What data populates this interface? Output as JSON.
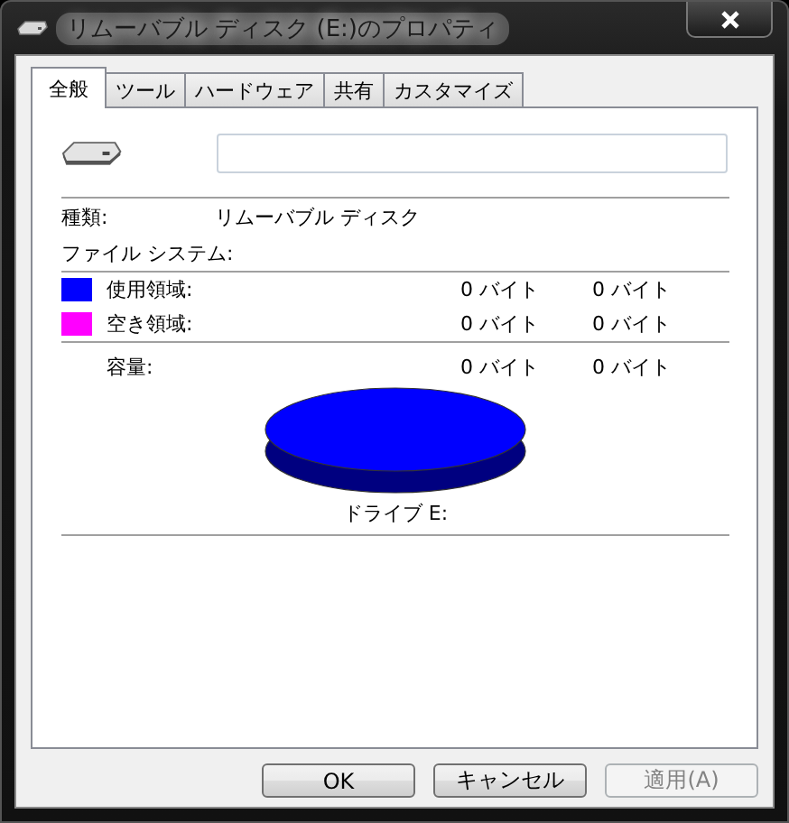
{
  "window": {
    "title": "リムーバブル ディスク (E:)のプロパティ"
  },
  "tabs": [
    {
      "label": "全般",
      "selected": true
    },
    {
      "label": "ツール",
      "selected": false
    },
    {
      "label": "ハードウェア",
      "selected": false
    },
    {
      "label": "共有",
      "selected": false
    },
    {
      "label": "カスタマイズ",
      "selected": false
    }
  ],
  "type": {
    "label": "種類:",
    "value": "リムーバブル ディスク"
  },
  "file_system": {
    "label": "ファイル システム:"
  },
  "space": [
    {
      "label": "使用領域:",
      "color": "#0000ff",
      "bytes": "0 バイト",
      "size": "0 バイト"
    },
    {
      "label": "空き領域:",
      "color": "#ff00ff",
      "bytes": "0 バイト",
      "size": "0 バイト"
    }
  ],
  "capacity": {
    "label": "容量:",
    "bytes": "0 バイト",
    "size": "0 バイト"
  },
  "drive_label": "ドライブ E:",
  "buttons": [
    {
      "label": "OK",
      "disabled": false
    },
    {
      "label": "キャンセル",
      "disabled": false
    },
    {
      "label": "適用(A)",
      "disabled": true
    }
  ]
}
